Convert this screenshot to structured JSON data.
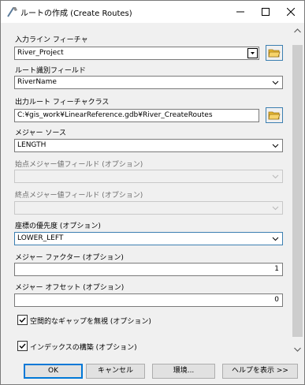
{
  "window": {
    "title": "ルートの作成 (Create Routes)"
  },
  "form": {
    "input_features": {
      "label": "入力ライン フィーチャ",
      "value": "River_Project"
    },
    "route_id_field": {
      "label": "ルート識別フィールド",
      "value": "RiverName"
    },
    "output_route_class": {
      "label": "出力ルート フィーチャクラス",
      "value": "C:¥gis_work¥LinearReference.gdb¥River_CreateRoutes"
    },
    "measure_source": {
      "label": "メジャー ソース",
      "value": "LENGTH"
    },
    "from_measure_field": {
      "label": "始点メジャー値フィールド (オプション)",
      "value": ""
    },
    "to_measure_field": {
      "label": "終点メジャー値フィールド (オプション)",
      "value": ""
    },
    "coordinate_priority": {
      "label": "座標の優先度 (オプション)",
      "value": "LOWER_LEFT"
    },
    "measure_factor": {
      "label": "メジャー ファクター (オプション)",
      "value": "1"
    },
    "measure_offset": {
      "label": "メジャー オフセット (オプション)",
      "value": "0"
    },
    "ignore_gaps": {
      "label": "空間的なギャップを無視 (オプション)",
      "checked": true
    },
    "build_index": {
      "label": "インデックスの構築 (オプション)",
      "checked": true
    }
  },
  "buttons": {
    "ok": "OK",
    "cancel": "キャンセル",
    "environments": "環境...",
    "show_help": "ヘルプを表示 >>"
  },
  "colors": {
    "window_bg": "#f0f0f0",
    "focus_border": "#3c7fb1",
    "folder_yellow": "#e8b830"
  }
}
